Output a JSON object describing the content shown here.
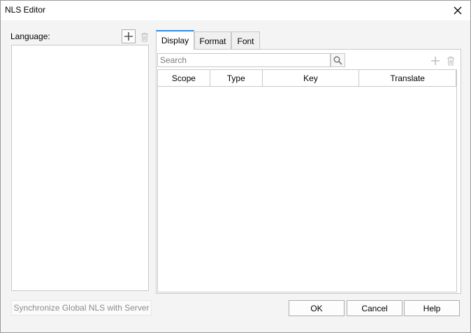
{
  "window": {
    "title": "NLS Editor"
  },
  "language": {
    "label": "Language:"
  },
  "tabs": [
    {
      "label": "Display",
      "active": true
    },
    {
      "label": "Format",
      "active": false
    },
    {
      "label": "Font",
      "active": false
    }
  ],
  "search": {
    "placeholder": "Search"
  },
  "table": {
    "columns": [
      "Scope",
      "Type",
      "Key",
      "Translate"
    ],
    "rows": []
  },
  "footer": {
    "sync_label": "Synchronize Global NLS with Server",
    "ok_label": "OK",
    "cancel_label": "Cancel",
    "help_label": "Help"
  },
  "colors": {
    "active_tab_accent": "#1e90ff",
    "disabled_icon": "#c0c0c0",
    "dialog_background": "#f4f4f4"
  }
}
